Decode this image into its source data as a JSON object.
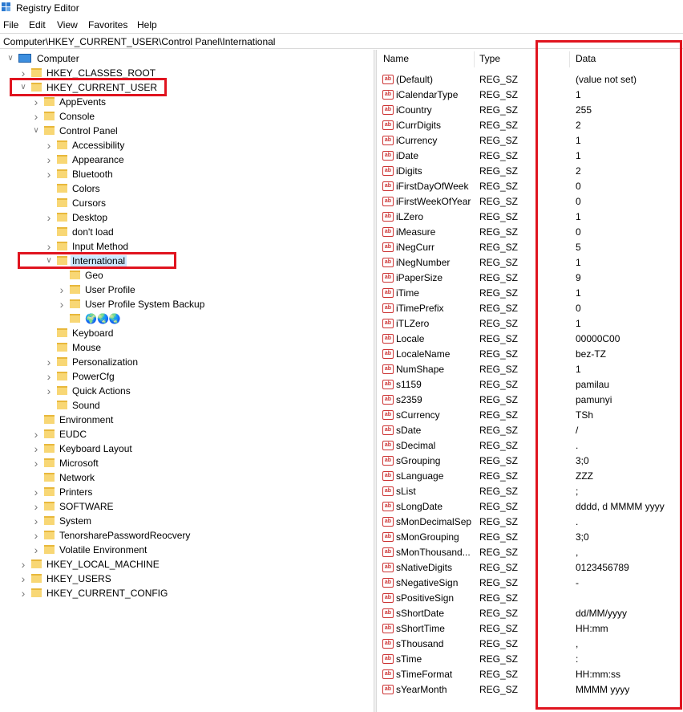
{
  "window": {
    "title": "Registry Editor"
  },
  "menu": [
    "File",
    "Edit",
    "View",
    "Favorites",
    "Help"
  ],
  "address": "Computer\\HKEY_CURRENT_USER\\Control Panel\\International",
  "tree": [
    {
      "label": "Computer",
      "exp": "down",
      "icon": "computer"
    },
    {
      "label": "HKEY_CLASSES_ROOT",
      "exp": "right",
      "icon": "folder"
    },
    {
      "label": "HKEY_CURRENT_USER",
      "exp": "down",
      "icon": "folder"
    },
    {
      "label": "AppEvents",
      "exp": "right",
      "icon": "folder"
    },
    {
      "label": "Console",
      "exp": "right",
      "icon": "folder"
    },
    {
      "label": "Control Panel",
      "exp": "down",
      "icon": "folder"
    },
    {
      "label": "Accessibility",
      "exp": "right",
      "icon": "folder"
    },
    {
      "label": "Appearance",
      "exp": "right",
      "icon": "folder"
    },
    {
      "label": "Bluetooth",
      "exp": "right",
      "icon": "folder"
    },
    {
      "label": "Colors",
      "exp": "",
      "icon": "folder"
    },
    {
      "label": "Cursors",
      "exp": "",
      "icon": "folder"
    },
    {
      "label": "Desktop",
      "exp": "right",
      "icon": "folder"
    },
    {
      "label": "don't load",
      "exp": "",
      "icon": "folder"
    },
    {
      "label": "Input Method",
      "exp": "right",
      "icon": "folder"
    },
    {
      "label": "International",
      "exp": "down",
      "icon": "folder"
    },
    {
      "label": "Geo",
      "exp": "",
      "icon": "folder"
    },
    {
      "label": "User Profile",
      "exp": "right",
      "icon": "folder"
    },
    {
      "label": "User Profile System Backup",
      "exp": "right",
      "icon": "folder"
    },
    {
      "label": "🌍🌏🌏",
      "exp": "",
      "icon": "folder"
    },
    {
      "label": "Keyboard",
      "exp": "",
      "icon": "folder"
    },
    {
      "label": "Mouse",
      "exp": "",
      "icon": "folder"
    },
    {
      "label": "Personalization",
      "exp": "right",
      "icon": "folder"
    },
    {
      "label": "PowerCfg",
      "exp": "right",
      "icon": "folder"
    },
    {
      "label": "Quick Actions",
      "exp": "right",
      "icon": "folder"
    },
    {
      "label": "Sound",
      "exp": "",
      "icon": "folder"
    },
    {
      "label": "Environment",
      "exp": "",
      "icon": "folder"
    },
    {
      "label": "EUDC",
      "exp": "right",
      "icon": "folder"
    },
    {
      "label": "Keyboard Layout",
      "exp": "right",
      "icon": "folder"
    },
    {
      "label": "Microsoft",
      "exp": "right",
      "icon": "folder"
    },
    {
      "label": "Network",
      "exp": "",
      "icon": "folder"
    },
    {
      "label": "Printers",
      "exp": "right",
      "icon": "folder"
    },
    {
      "label": "SOFTWARE",
      "exp": "right",
      "icon": "folder"
    },
    {
      "label": "System",
      "exp": "right",
      "icon": "folder"
    },
    {
      "label": "TenorsharePasswordReocvery",
      "exp": "right",
      "icon": "folder"
    },
    {
      "label": "Volatile Environment",
      "exp": "right",
      "icon": "folder"
    },
    {
      "label": "HKEY_LOCAL_MACHINE",
      "exp": "right",
      "icon": "folder"
    },
    {
      "label": "HKEY_USERS",
      "exp": "right",
      "icon": "folder"
    },
    {
      "label": "HKEY_CURRENT_CONFIG",
      "exp": "right",
      "icon": "folder"
    }
  ],
  "columns": {
    "name": "Name",
    "type": "Type",
    "data": "Data"
  },
  "values": [
    {
      "name": "(Default)",
      "type": "REG_SZ",
      "data": "(value not set)"
    },
    {
      "name": "iCalendarType",
      "type": "REG_SZ",
      "data": "1"
    },
    {
      "name": "iCountry",
      "type": "REG_SZ",
      "data": "255"
    },
    {
      "name": "iCurrDigits",
      "type": "REG_SZ",
      "data": "2"
    },
    {
      "name": "iCurrency",
      "type": "REG_SZ",
      "data": "1"
    },
    {
      "name": "iDate",
      "type": "REG_SZ",
      "data": "1"
    },
    {
      "name": "iDigits",
      "type": "REG_SZ",
      "data": "2"
    },
    {
      "name": "iFirstDayOfWeek",
      "type": "REG_SZ",
      "data": "0"
    },
    {
      "name": "iFirstWeekOfYear",
      "type": "REG_SZ",
      "data": "0"
    },
    {
      "name": "iLZero",
      "type": "REG_SZ",
      "data": "1"
    },
    {
      "name": "iMeasure",
      "type": "REG_SZ",
      "data": "0"
    },
    {
      "name": "iNegCurr",
      "type": "REG_SZ",
      "data": "5"
    },
    {
      "name": "iNegNumber",
      "type": "REG_SZ",
      "data": "1"
    },
    {
      "name": "iPaperSize",
      "type": "REG_SZ",
      "data": "9"
    },
    {
      "name": "iTime",
      "type": "REG_SZ",
      "data": "1"
    },
    {
      "name": "iTimePrefix",
      "type": "REG_SZ",
      "data": "0"
    },
    {
      "name": "iTLZero",
      "type": "REG_SZ",
      "data": "1"
    },
    {
      "name": "Locale",
      "type": "REG_SZ",
      "data": "00000C00"
    },
    {
      "name": "LocaleName",
      "type": "REG_SZ",
      "data": "bez-TZ"
    },
    {
      "name": "NumShape",
      "type": "REG_SZ",
      "data": "1"
    },
    {
      "name": "s1159",
      "type": "REG_SZ",
      "data": "pamilau"
    },
    {
      "name": "s2359",
      "type": "REG_SZ",
      "data": "pamunyi"
    },
    {
      "name": "sCurrency",
      "type": "REG_SZ",
      "data": "TSh"
    },
    {
      "name": "sDate",
      "type": "REG_SZ",
      "data": "/"
    },
    {
      "name": "sDecimal",
      "type": "REG_SZ",
      "data": "."
    },
    {
      "name": "sGrouping",
      "type": "REG_SZ",
      "data": "3;0"
    },
    {
      "name": "sLanguage",
      "type": "REG_SZ",
      "data": "ZZZ"
    },
    {
      "name": "sList",
      "type": "REG_SZ",
      "data": ";"
    },
    {
      "name": "sLongDate",
      "type": "REG_SZ",
      "data": "dddd, d MMMM yyyy"
    },
    {
      "name": "sMonDecimalSep",
      "type": "REG_SZ",
      "data": "."
    },
    {
      "name": "sMonGrouping",
      "type": "REG_SZ",
      "data": "3;0"
    },
    {
      "name": "sMonThousand...",
      "type": "REG_SZ",
      "data": ","
    },
    {
      "name": "sNativeDigits",
      "type": "REG_SZ",
      "data": "0123456789"
    },
    {
      "name": "sNegativeSign",
      "type": "REG_SZ",
      "data": "-"
    },
    {
      "name": "sPositiveSign",
      "type": "REG_SZ",
      "data": ""
    },
    {
      "name": "sShortDate",
      "type": "REG_SZ",
      "data": "dd/MM/yyyy"
    },
    {
      "name": "sShortTime",
      "type": "REG_SZ",
      "data": "HH:mm"
    },
    {
      "name": "sThousand",
      "type": "REG_SZ",
      "data": ","
    },
    {
      "name": "sTime",
      "type": "REG_SZ",
      "data": ":"
    },
    {
      "name": "sTimeFormat",
      "type": "REG_SZ",
      "data": "HH:mm:ss"
    },
    {
      "name": "sYearMonth",
      "type": "REG_SZ",
      "data": "MMMM yyyy"
    }
  ],
  "ab_icon_text": "ab",
  "colors": {
    "highlight_box": "#e0141f",
    "selection": "#cce8ff",
    "folder": "#f8d775"
  }
}
